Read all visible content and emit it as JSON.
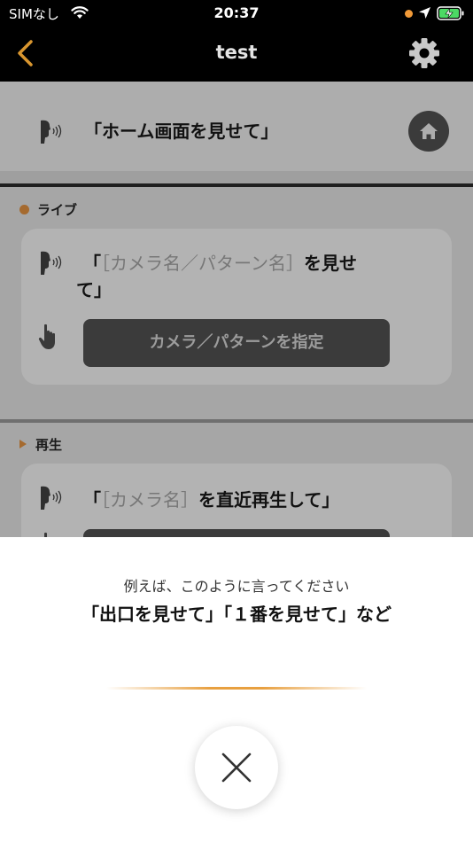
{
  "status_bar": {
    "carrier": "SIMなし",
    "time": "20:37"
  },
  "nav": {
    "title": "test",
    "back_icon": "chevron-left-icon",
    "settings_icon": "gear-icon",
    "accent_color": "#d9962f"
  },
  "content": {
    "home_command": "「ホーム画面を見せて」",
    "live": {
      "label": "ライブ",
      "command_open": "「",
      "placeholder": "［カメラ名／パターン名］",
      "command_suffix_1": "を見せ",
      "command_suffix_2": "て」",
      "select_button": "カメラ／パターンを指定"
    },
    "playback": {
      "label": "再生",
      "command_open": "「",
      "placeholder": "［カメラ名］",
      "command_suffix": "を直近再生して」"
    }
  },
  "sheet": {
    "hint": "例えば、このように言ってください",
    "example": "「出口を見せて」「１番を見せて」など",
    "close_icon": "close-icon"
  }
}
